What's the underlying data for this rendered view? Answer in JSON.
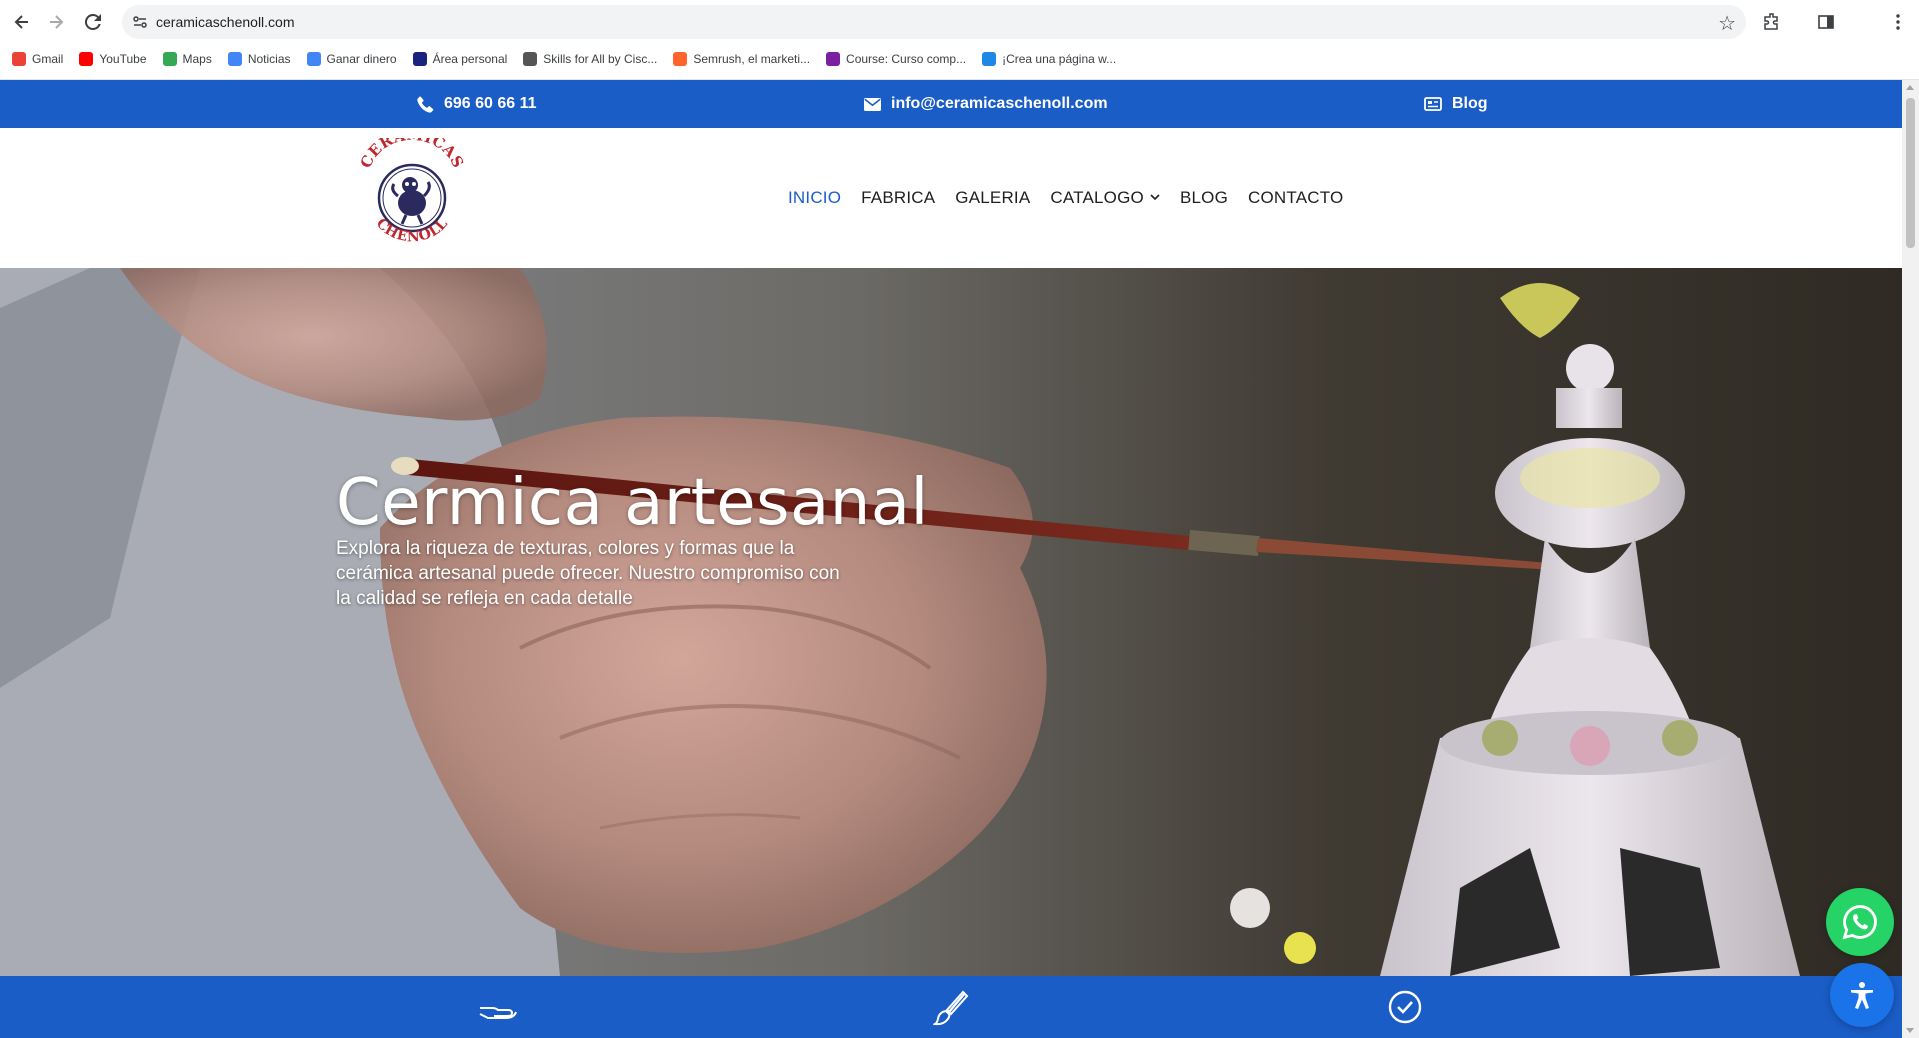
{
  "browser": {
    "url": "ceramicaschenoll.com",
    "bookmarks": [
      {
        "label": "Gmail",
        "icon": "gmail-icon",
        "color": "#ea4335"
      },
      {
        "label": "YouTube",
        "icon": "youtube-icon",
        "color": "#ff0000"
      },
      {
        "label": "Maps",
        "icon": "maps-icon",
        "color": "#34a853"
      },
      {
        "label": "Noticias",
        "icon": "news-icon",
        "color": "#4285f4"
      },
      {
        "label": "Ganar dinero",
        "icon": "sparkle-icon",
        "color": "#4285f4"
      },
      {
        "label": "Área personal",
        "icon": "puzzle-icon",
        "color": "#1a237e"
      },
      {
        "label": "Skills for All by Cisc...",
        "icon": "cisco-icon",
        "color": "#555555"
      },
      {
        "label": "Semrush, el marketi...",
        "icon": "semrush-icon",
        "color": "#ff642d"
      },
      {
        "label": "Course: Curso comp...",
        "icon": "course-icon",
        "color": "#7b1fa2"
      },
      {
        "label": "¡Crea una página w...",
        "icon": "wn-icon",
        "color": "#1e88e5"
      }
    ]
  },
  "topbar": {
    "phone": "696 60 66 11",
    "email": "info@ceramicaschenoll.com",
    "blog": "Blog"
  },
  "logo": {
    "top_text": "CERÁMICAS",
    "bottom_text": "CHENOLL"
  },
  "menu": [
    {
      "label": "INICIO",
      "active": true
    },
    {
      "label": "FABRICA",
      "active": false
    },
    {
      "label": "GALERIA",
      "active": false
    },
    {
      "label": "CATALOGO",
      "active": false,
      "dropdown": true
    },
    {
      "label": "BLOG",
      "active": false
    },
    {
      "label": "CONTACTO",
      "active": false
    }
  ],
  "hero": {
    "title": "Cermica artesanal",
    "text": "Explora la riqueza de texturas, colores y formas que la cerámica artesanal puede ofrecer. Nuestro compromiso con la calidad se refleja en cada detalle"
  },
  "colors": {
    "brand_blue": "#1a5dc7",
    "whatsapp_green": "#25d366",
    "access_blue": "#1a73e8"
  }
}
